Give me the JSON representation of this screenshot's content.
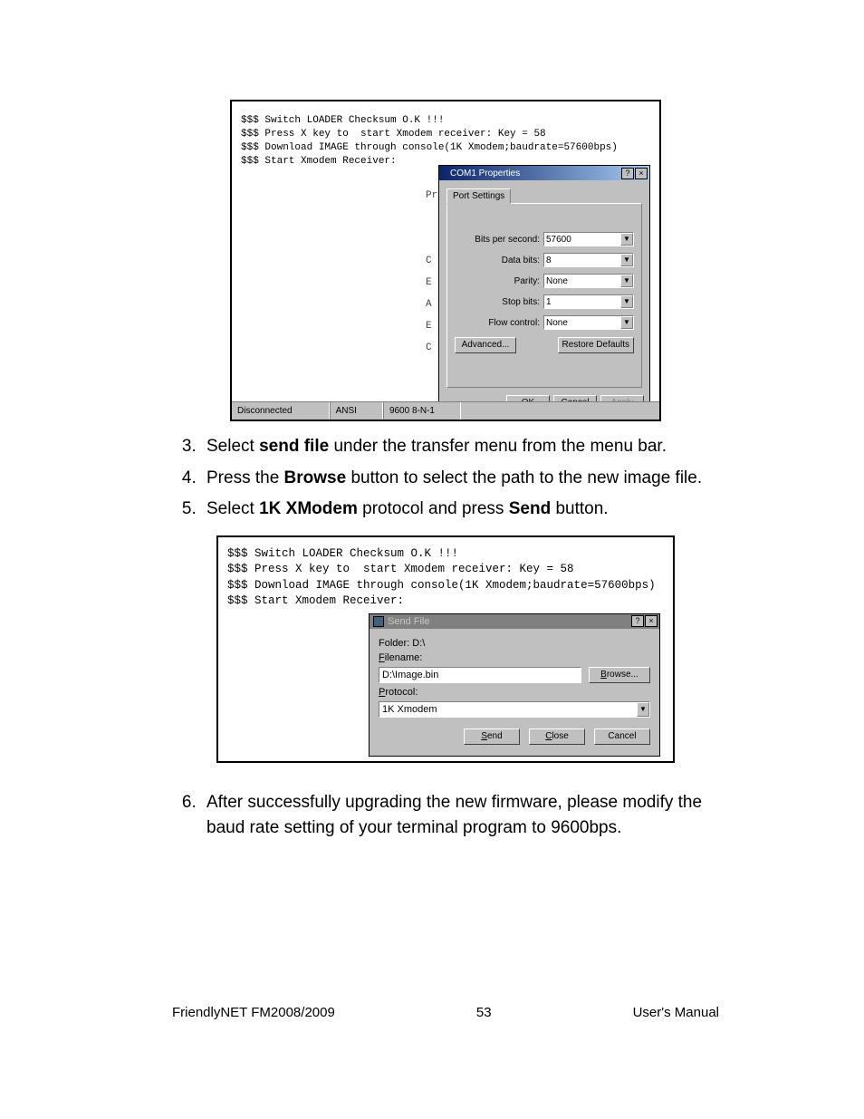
{
  "shot1": {
    "console_lines": "$$$ Switch LOADER Checksum O.K !!!\n$$$ Press X key to  start Xmodem receiver: Key = 58\n$$$ Download IMAGE through console(1K Xmodem;baudrate=57600bps)\n$$$ Start Xmodem Receiver:",
    "status": {
      "c1": "Disconnected",
      "c2": "ANSI",
      "c3": "9600 8-N-1"
    },
    "props": {
      "title": "COM1 Properties",
      "help": "?",
      "close": "×",
      "tab": "Port Settings",
      "fields": {
        "bps_label": "Bits per second:",
        "bps_value": "57600",
        "data_label": "Data bits:",
        "data_value": "8",
        "parity_label": "Parity:",
        "parity_value": "None",
        "stop_label": "Stop bits:",
        "stop_value": "1",
        "flow_label": "Flow control:",
        "flow_value": "None"
      },
      "advanced": "Advanced...",
      "restore": "Restore Defaults",
      "ok": "OK",
      "cancel": "Cancel",
      "apply": "Apply"
    }
  },
  "instructions": {
    "i3_a": "Select ",
    "i3_b": "send file",
    "i3_c": " under the transfer menu from the menu bar.",
    "i4_a": "Press the ",
    "i4_b": "Browse",
    "i4_c": " button to select the path to the new image file.",
    "i5_a": "Select ",
    "i5_b": "1K XModem",
    "i5_c": " protocol and press ",
    "i5_d": "Send",
    "i5_e": " button.",
    "i6": "After successfully upgrading the new firmware, please modify the baud rate setting of your terminal program to 9600bps."
  },
  "shot2": {
    "console_lines": "$$$ Switch LOADER Checksum O.K !!!\n$$$ Press X key to  start Xmodem receiver: Key = 58\n$$$ Download IMAGE through console(1K Xmodem;baudrate=57600bps)\n$$$ Start Xmodem Receiver:",
    "send": {
      "title": "Send File",
      "help": "?",
      "close": "×",
      "folder_label": "Folder: D:\\",
      "filename_label": "Filename:",
      "filename_value": "D:\\Image.bin",
      "browse": "Browse...",
      "protocol_label": "Protocol:",
      "protocol_value": "1K Xmodem",
      "send_btn": "Send",
      "close_btn": "Close",
      "cancel_btn": "Cancel"
    }
  },
  "footer": {
    "left": "FriendlyNET FM2008/2009",
    "center": "53",
    "right": "User's Manual"
  }
}
